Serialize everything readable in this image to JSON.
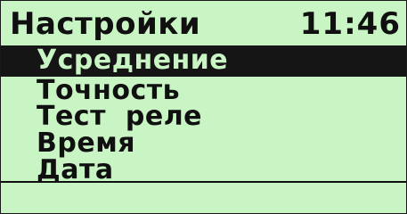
{
  "header": {
    "title": "Настройки",
    "time": "11:46"
  },
  "menu": {
    "selected_index": 0,
    "items": [
      {
        "label": "Усреднение"
      },
      {
        "label": "Точность"
      },
      {
        "label": "Тест  реле"
      },
      {
        "label": "Время"
      },
      {
        "label": "Дата"
      }
    ]
  },
  "colors": {
    "screen_background": "#c9f5c4",
    "text": "#101010",
    "selection_background": "#151515"
  }
}
